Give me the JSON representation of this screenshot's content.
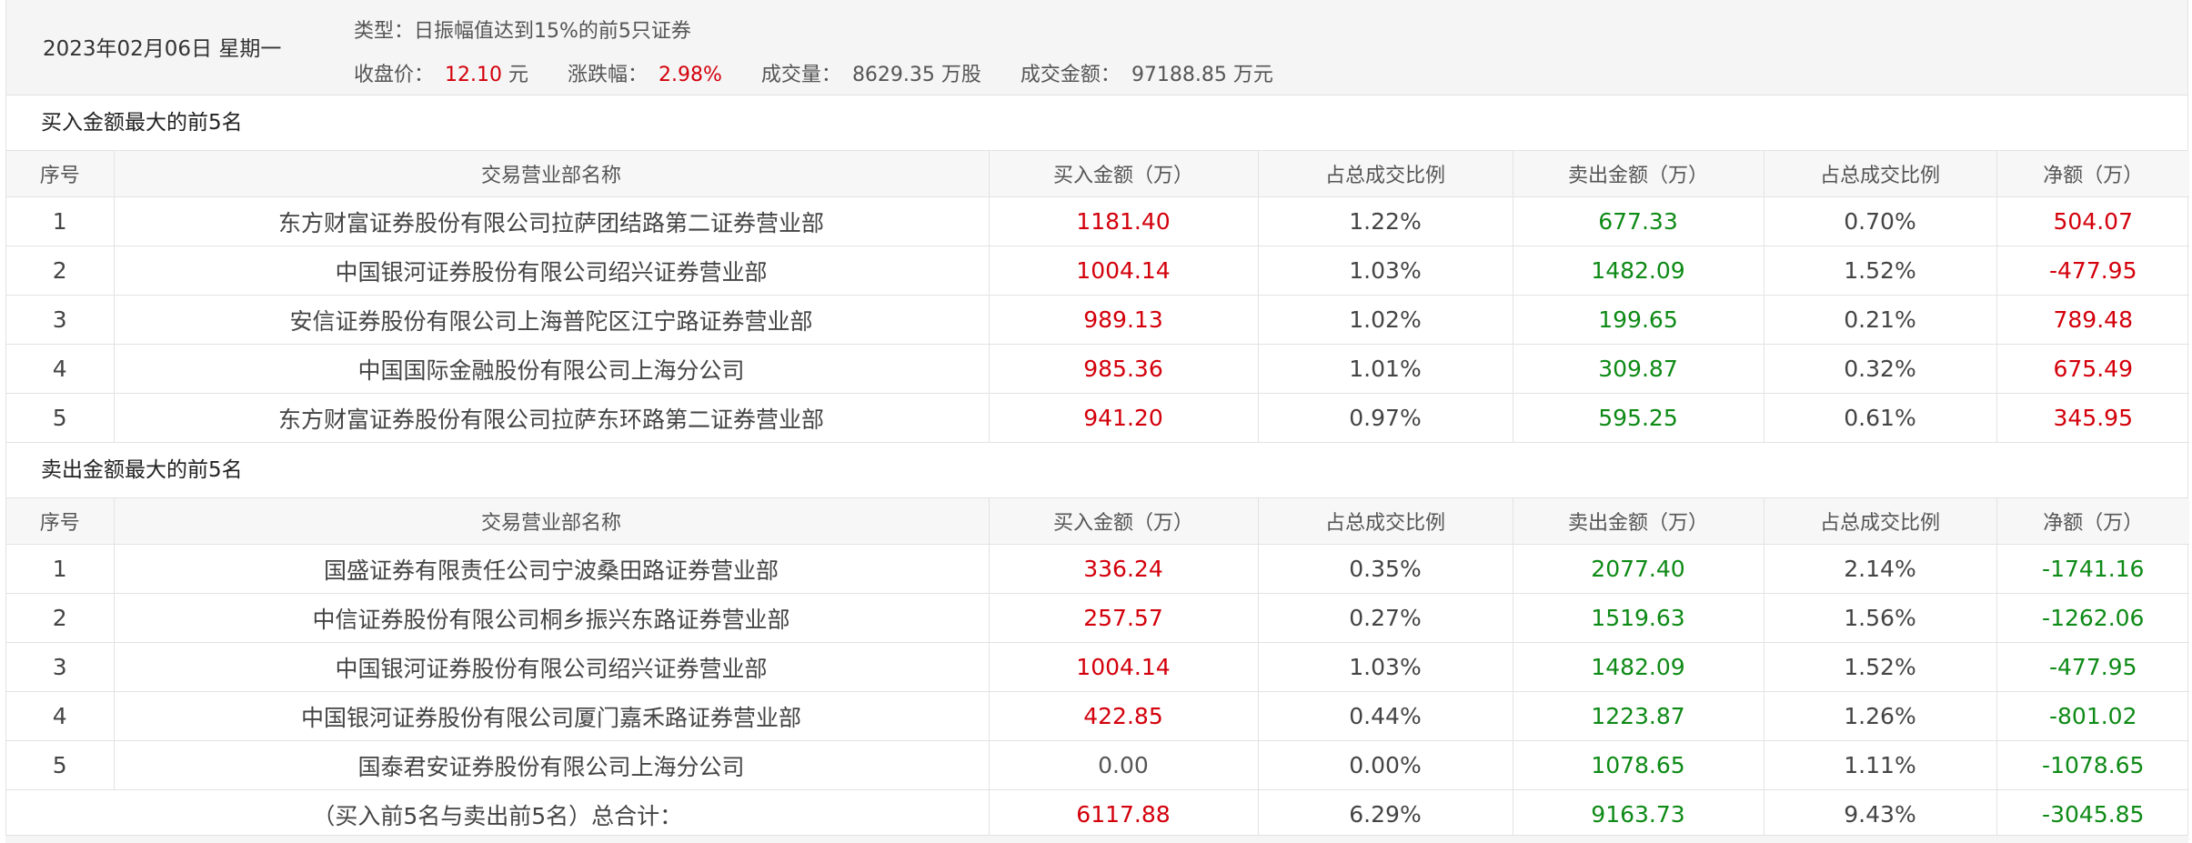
{
  "header": {
    "date": "2023年02月06日 星期一",
    "type_label": "类型：",
    "type_value": "日振幅值达到15%的前5只证券",
    "close_label": "收盘价：",
    "close_value": "12.10",
    "close_unit": "元",
    "change_label": "涨跌幅：",
    "change_value": "2.98%",
    "volume_label": "成交量：",
    "volume_value": "8629.35 万股",
    "turnover_label": "成交金额：",
    "turnover_value": "97188.85 万元"
  },
  "columns": [
    "序号",
    "交易营业部名称",
    "买入金额（万）",
    "占总成交比例",
    "卖出金额（万）",
    "占总成交比例",
    "净额（万）"
  ],
  "buy_section": {
    "title": "买入金额最大的前5名",
    "rows": [
      [
        "1",
        "东方财富证券股份有限公司拉萨团结路第二证券营业部",
        "1181.40",
        "1.22%",
        "677.33",
        "0.70%",
        "504.07"
      ],
      [
        "2",
        "中国银河证券股份有限公司绍兴证券营业部",
        "1004.14",
        "1.03%",
        "1482.09",
        "1.52%",
        "-477.95"
      ],
      [
        "3",
        "安信证券股份有限公司上海普陀区江宁路证券营业部",
        "989.13",
        "1.02%",
        "199.65",
        "0.21%",
        "789.48"
      ],
      [
        "4",
        "中国国际金融股份有限公司上海分公司",
        "985.36",
        "1.01%",
        "309.87",
        "0.32%",
        "675.49"
      ],
      [
        "5",
        "东方财富证券股份有限公司拉萨东环路第二证券营业部",
        "941.20",
        "0.97%",
        "595.25",
        "0.61%",
        "345.95"
      ]
    ]
  },
  "sell_section": {
    "title": "卖出金额最大的前5名",
    "rows": [
      [
        "1",
        "国盛证券有限责任公司宁波桑田路证券营业部",
        "336.24",
        "0.35%",
        "2077.40",
        "2.14%",
        "-1741.16"
      ],
      [
        "2",
        "中信证券股份有限公司桐乡振兴东路证券营业部",
        "257.57",
        "0.27%",
        "1519.63",
        "1.56%",
        "-1262.06"
      ],
      [
        "3",
        "中国银河证券股份有限公司绍兴证券营业部",
        "1004.14",
        "1.03%",
        "1482.09",
        "1.52%",
        "-477.95"
      ],
      [
        "4",
        "中国银河证券股份有限公司厦门嘉禾路证券营业部",
        "422.85",
        "0.44%",
        "1223.87",
        "1.26%",
        "-801.02"
      ],
      [
        "5",
        "国泰君安证券股份有限公司上海分公司",
        "0.00",
        "0.00%",
        "1078.65",
        "1.11%",
        "-1078.65"
      ]
    ]
  },
  "total": {
    "label": "（买入前5名与卖出前5名）总合计：",
    "buy": "6117.88",
    "buy_pct": "6.29%",
    "sell": "9163.73",
    "sell_pct": "9.43%",
    "net": "-3045.85"
  },
  "colors": {
    "positive": "#d3000b",
    "negative": "#0e8a16",
    "neutral": "#555555"
  }
}
